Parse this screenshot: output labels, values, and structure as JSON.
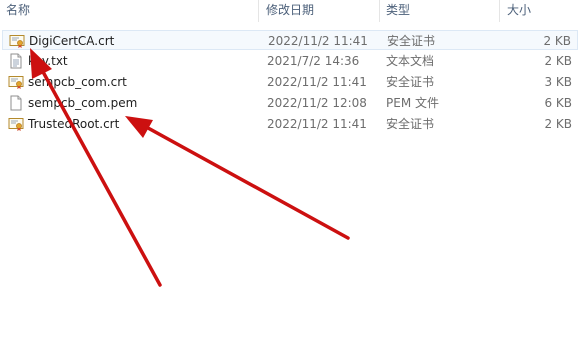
{
  "header": {
    "name": "名称",
    "date": "修改日期",
    "type": "类型",
    "size": "大小"
  },
  "files": [
    {
      "name": "DigiCertCA.crt",
      "date": "2022/11/2 11:41",
      "type": "安全证书",
      "size": "2 KB",
      "icon": "certificate-icon",
      "selected": true
    },
    {
      "name": "key.txt",
      "date": "2021/7/2 14:36",
      "type": "文本文档",
      "size": "2 KB",
      "icon": "text-file-icon"
    },
    {
      "name": "sempcb_com.crt",
      "date": "2022/11/2 11:41",
      "type": "安全证书",
      "size": "3 KB",
      "icon": "certificate-icon"
    },
    {
      "name": "sempcb_com.pem",
      "date": "2022/11/2 12:08",
      "type": "PEM 文件",
      "size": "6 KB",
      "icon": "blank-file-icon"
    },
    {
      "name": "TrustedRoot.crt",
      "date": "2022/11/2 11:41",
      "type": "安全证书",
      "size": "2 KB",
      "icon": "certificate-icon"
    }
  ],
  "annotation_color": "#cc1010"
}
